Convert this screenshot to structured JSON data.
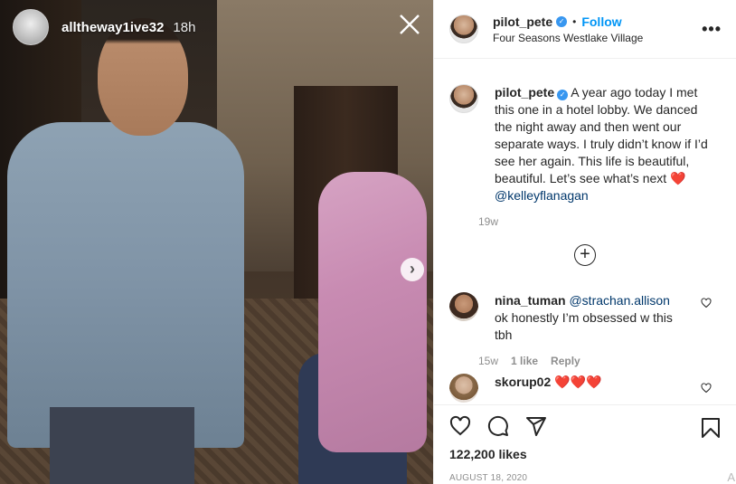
{
  "media": {
    "username": "alltheway1ive32",
    "time": "18h",
    "close_icon": "close-icon",
    "next_icon": "chevron-right-icon"
  },
  "post": {
    "username": "pilot_pete",
    "separator": "•",
    "follow_label": "Follow",
    "location": "Four Seasons Westlake Village",
    "more_label": "•••"
  },
  "caption": {
    "username": "pilot_pete",
    "text": "A year ago today I met this one in a hotel lobby. We danced the night away and then went our separate ways. I truly didn’t know if I’d see her again. This life is beautiful, beautiful. Let’s see what’s next",
    "heart": "❤️",
    "mention": "@kelleyflanagan",
    "time": "19w"
  },
  "load_more_label": "+",
  "comments": [
    {
      "username": "nina_tuman",
      "mention": "@strachan.allison",
      "text": "ok honestly I’m obsessed w this tbh",
      "time": "15w",
      "likes": "1 like",
      "reply": "Reply"
    },
    {
      "username": "skorup02",
      "text": "❤️❤️❤️"
    }
  ],
  "likes": "122,200 likes",
  "date": "AUGUST 18, 2020",
  "corner_text": "A",
  "colors": {
    "accent": "#0095f6",
    "verified": "#3897f0",
    "heart": "#e0245e"
  }
}
